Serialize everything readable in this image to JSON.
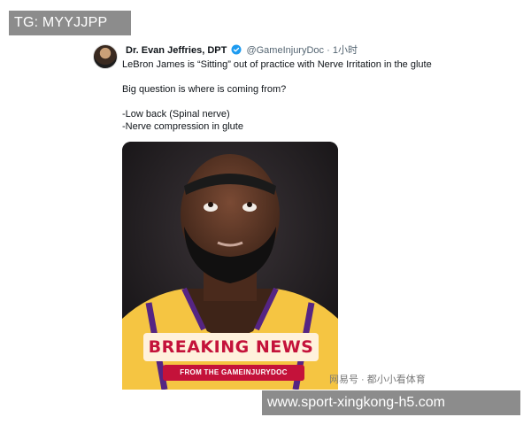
{
  "overlay": {
    "top_left_banner": "TG: MYYJJPP",
    "bottom_right_banner": "www.sport-xingkong-h5.com",
    "watermark": "网易号 · 都小小看体育"
  },
  "tweet": {
    "author_name": "Dr. Evan Jeffries, DPT",
    "handle": "@GameInjuryDoc",
    "separator": "·",
    "time": "1小时",
    "lines": [
      "LeBron James is “Sitting” out of practice with Nerve Irritation in the glute",
      "Big question is where is coming from?",
      "-Low back (Spinal nerve)",
      "-Nerve compression in glute"
    ],
    "media": {
      "headline": "BREAKING NEWS",
      "subheadline": "FROM THE GAMEINJURYDOC"
    }
  },
  "colors": {
    "verified": "#1d9bf0",
    "breaking_red": "#c4123a",
    "jersey_gold": "#f5c542",
    "jersey_purple": "#552583"
  }
}
